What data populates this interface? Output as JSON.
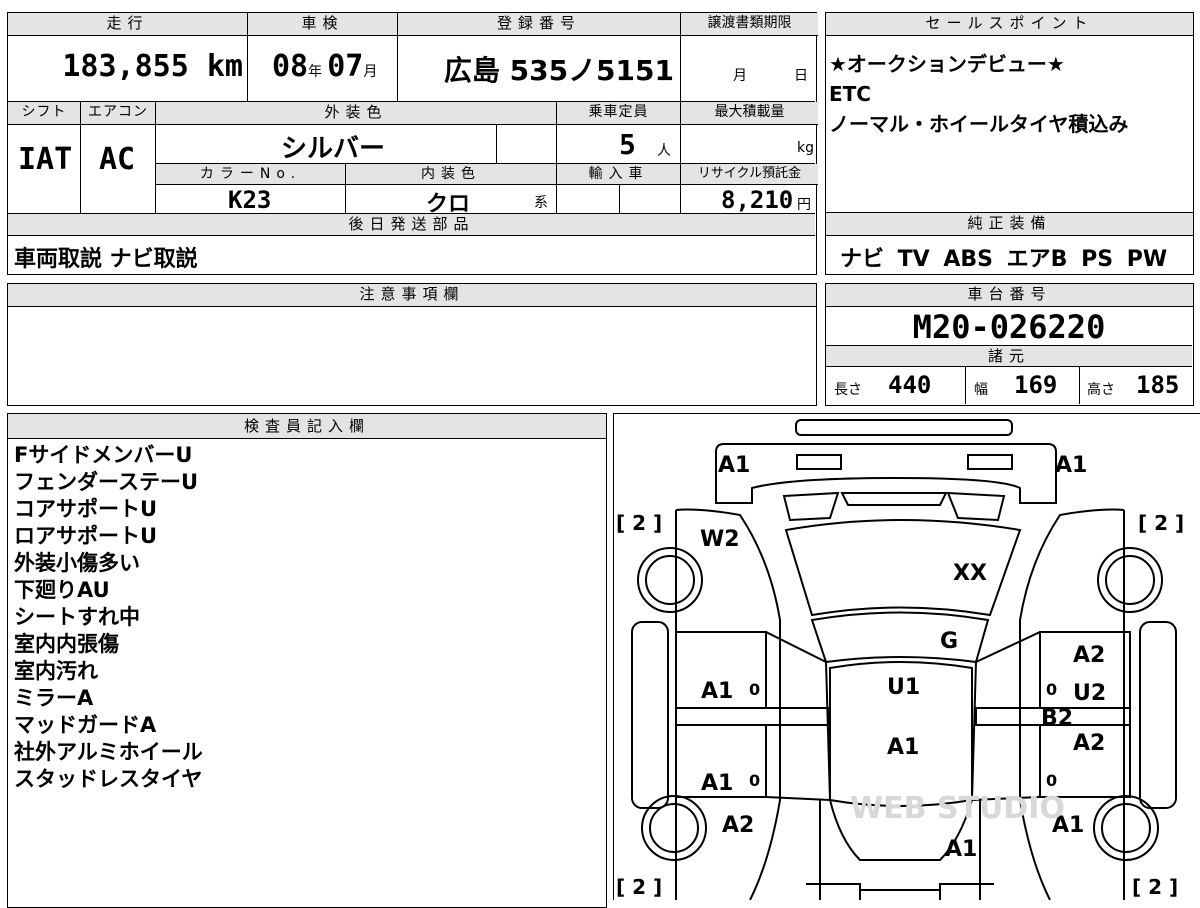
{
  "sheet": {
    "mileage": {
      "label": "走行",
      "value": "183,855",
      "unit": "km"
    },
    "inspection": {
      "label": "車検",
      "year": "08",
      "year_unit": "年",
      "month": "07",
      "month_unit": "月"
    },
    "registration": {
      "label": "登録番号",
      "value": "広島 535ノ5151"
    },
    "transfer_deadline": {
      "label": "譲渡書類期限",
      "month_unit": "月",
      "day_unit": "日"
    },
    "shift": {
      "label": "シフト",
      "value": "IAT"
    },
    "aircon": {
      "label": "エアコン",
      "value": "AC"
    },
    "exterior_color": {
      "label": "外装色",
      "value": "シルバー"
    },
    "capacity": {
      "label": "乗車定員",
      "value": "5",
      "unit": "人"
    },
    "max_load": {
      "label": "最大積載量",
      "unit": "kg"
    },
    "color_no": {
      "label": "カラーNo.",
      "value": "K23"
    },
    "interior_color": {
      "label": "内装色",
      "value": "クロ",
      "suffix": "系"
    },
    "import": {
      "label": "輸入車"
    },
    "recycle_fee": {
      "label": "リサイクル預託金",
      "value": "8,210",
      "unit": "円"
    },
    "later_parts": {
      "label": "後日発送部品",
      "value": "車両取説 ナビ取説"
    },
    "notes": {
      "label": "注意事項欄",
      "value": ""
    }
  },
  "sales_points": {
    "label": "セールスポイント",
    "lines": [
      "★オークションデビュー★",
      "ETC",
      "ノーマル・ホイールタイヤ積込み"
    ]
  },
  "equipment": {
    "label": "純正装備",
    "value": "ナビ TV ABS エアB PS PW"
  },
  "chassis": {
    "label": "車台番号",
    "value": "M20-026220"
  },
  "specs": {
    "label": "諸元",
    "length_label": "長さ",
    "length": "440",
    "width_label": "幅",
    "width": "169",
    "height_label": "高さ",
    "height": "185"
  },
  "inspector": {
    "label": "検査員記入欄",
    "lines": [
      "FサイドメンバーU",
      "フェンダーステーU",
      "コアサポートU",
      "ロアサポートU",
      "外装小傷多い",
      "下廻りAU",
      "シートすれ中",
      "室内内張傷",
      "室内汚れ",
      "ミラーA",
      "マッドガードA",
      "社外アルミホイール",
      "スタッドレスタイヤ"
    ]
  },
  "diagram": {
    "marks": {
      "front_left": "A1",
      "front_right": "A1",
      "tire_fl": "[ 2 ]",
      "tire_fr": "[ 2 ]",
      "tire_rl": "[ 2 ]",
      "tire_rr": "[ 2 ]",
      "windshield": "W2",
      "hood": "XX",
      "grille": "G",
      "roof_front": "U1",
      "roof_rear": "A1",
      "left_front_door": "A1",
      "left_rear_door": "A1",
      "right_fender": "A2",
      "right_front_door": "U2",
      "right_pillar": "B2",
      "right_rear_door": "A2",
      "left_rear_quarter": "A2",
      "right_rear_quarter": "A1",
      "rear": "A1",
      "small_0_1": "0",
      "small_0_2": "0",
      "small_0_3": "0",
      "small_0_4": "0"
    },
    "watermark": "WEB STUDIO"
  }
}
